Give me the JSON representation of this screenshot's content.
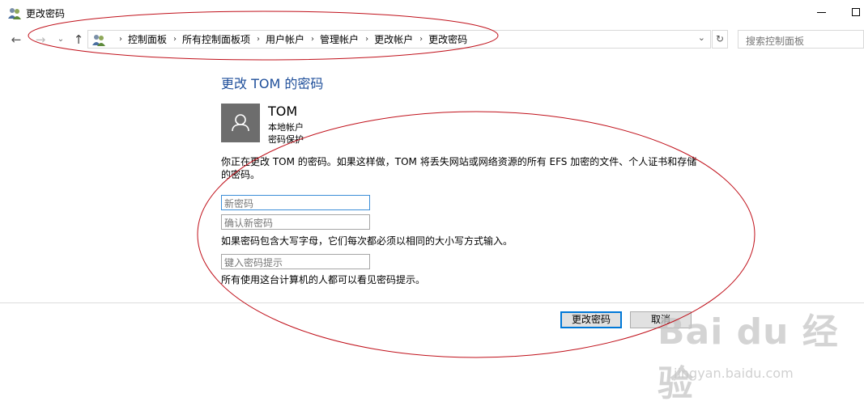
{
  "window": {
    "title": "更改密码"
  },
  "breadcrumb": [
    "控制面板",
    "所有控制面板项",
    "用户帐户",
    "管理帐户",
    "更改帐户",
    "更改密码"
  ],
  "search": {
    "placeholder": "搜索控制面板"
  },
  "page": {
    "title": "更改 TOM 的密码",
    "user": {
      "name": "TOM",
      "type": "本地帐户",
      "status": "密码保护"
    },
    "warning": "你正在更改 TOM 的密码。如果这样做，TOM 将丢失网站或网络资源的所有 EFS 加密的文件、个人证书和存储的密码。",
    "fields": {
      "new_password_placeholder": "新密码",
      "confirm_password_placeholder": "确认新密码",
      "hint_placeholder": "键入密码提示"
    },
    "case_note": "如果密码包含大写字母，它们每次都必须以相同的大小写方式输入。",
    "hint_note": "所有使用这台计算机的人都可以看见密码提示。"
  },
  "buttons": {
    "change": "更改密码",
    "cancel": "取消"
  },
  "watermark": {
    "logo": "Bai du 经验",
    "url": "jingyan.baidu.com"
  },
  "annotation_color": "#c0101a"
}
